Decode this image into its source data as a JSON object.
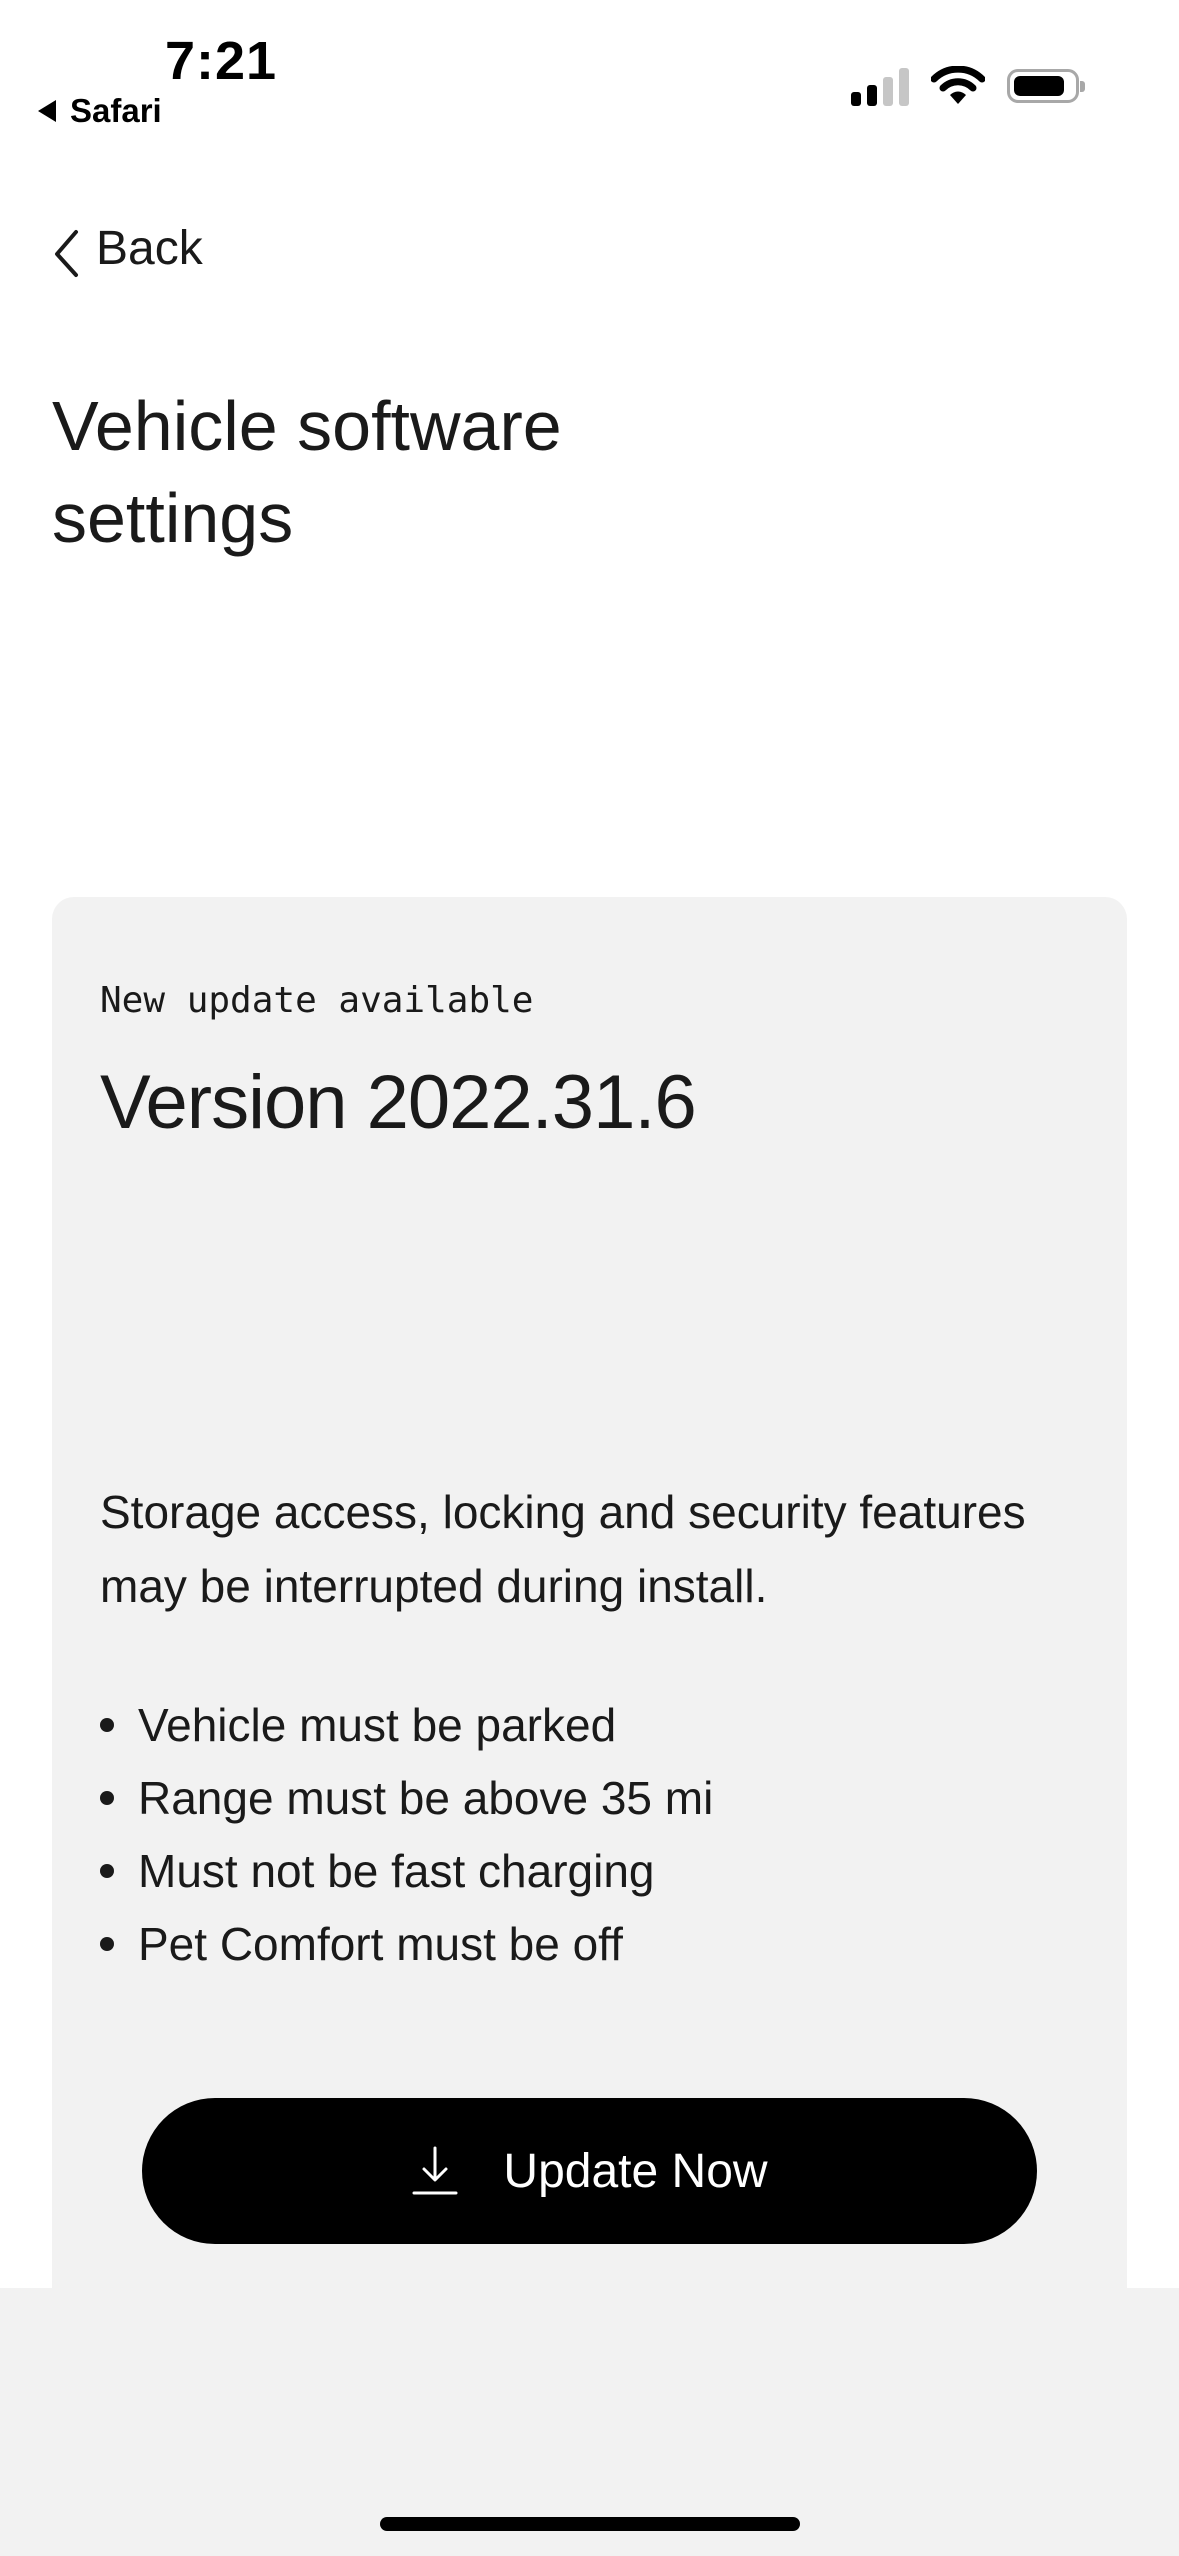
{
  "status_bar": {
    "time": "7:21",
    "back_app": "Safari",
    "icons": [
      "back-triangle-icon",
      "cellular-signal-icon",
      "wifi-icon",
      "battery-icon"
    ]
  },
  "nav": {
    "back_label": "Back"
  },
  "page": {
    "title": "Vehicle software settings"
  },
  "update_card": {
    "eyebrow": "New update available",
    "version": "Version 2022.31.6",
    "warning": "Storage access, locking and security features may be interrupted during install.",
    "requirements": [
      "Vehicle must be parked",
      "Range must be above 35 mi",
      "Must not be fast charging",
      "Pet Comfort must be off"
    ],
    "button_label": "Update Now",
    "button_icon": "download-icon"
  },
  "colors": {
    "background": "#ffffff",
    "card_background": "#f2f2f2",
    "text": "#1a1a1a",
    "button_background": "#000000",
    "button_text": "#ffffff"
  }
}
